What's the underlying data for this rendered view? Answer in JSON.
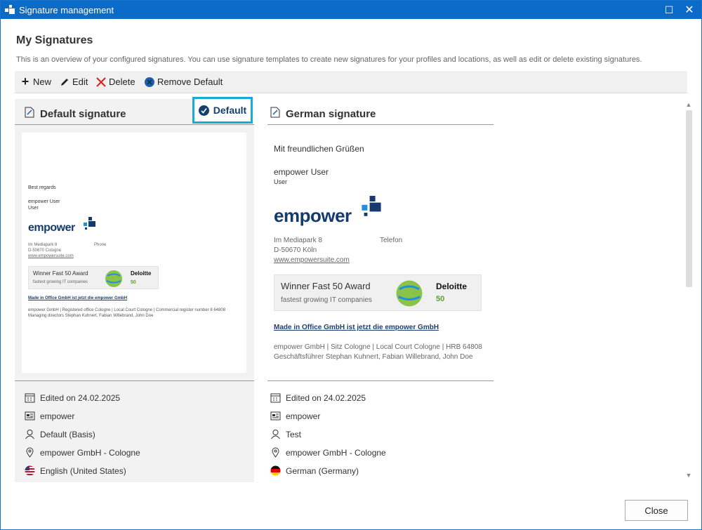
{
  "window": {
    "title": "Signature management"
  },
  "page": {
    "title": "My Signatures",
    "description": "This is an overview of your configured signatures. You can use signature templates to create new signatures for your profiles and locations, as well as edit or delete existing signatures."
  },
  "toolbar": {
    "new_label": "New",
    "edit_label": "Edit",
    "delete_label": "Delete",
    "remove_default_label": "Remove Default"
  },
  "cards": [
    {
      "title": "Default signature",
      "badge": "Default",
      "preview": {
        "greeting": "Best regards",
        "name": "empower User",
        "role": "User",
        "logo": "empower",
        "address1": "Im Mediapark 8",
        "address2": "D-50670 Cologne",
        "website": "www.empowersuite.com",
        "phone_label": "Phone",
        "award_title": "Winner Fast 50 Award",
        "award_sub": "fastest growing IT companies",
        "deloitte": "Deloitte",
        "fifty": "50",
        "made_in": "Made in Office GmbH ist jetzt die empower GmbH",
        "footer1": "empower GmbH | Registered office Cologne | Local Court Cologne | Commercial register number 8 64808",
        "footer2": "Managing directors Stephan Kuhnert, Fabian Willebrand, John Doe"
      },
      "meta": {
        "edited": "Edited on 24.02.2025",
        "company": "empower",
        "profile": "Default (Basis)",
        "location": "empower GmbH - Cologne",
        "language": "English (United States)"
      }
    },
    {
      "title": "German signature",
      "preview": {
        "greeting": "Mit freundlichen Grüßen",
        "name": "empower User",
        "role": "User",
        "logo": "empower",
        "address1": "Im Mediapark 8",
        "address2": "D-50670 Köln",
        "website": "www.empowersuite.com",
        "phone_label": "Telefon",
        "award_title": "Winner Fast 50 Award",
        "award_sub": "fastest growing IT companies",
        "deloitte": "Deloitte",
        "fifty": "50",
        "made_in": "Made in Office GmbH ist jetzt die empower GmbH",
        "footer1": "empower GmbH | Sitz Cologne | Local Court Cologne | HRB 64808",
        "footer2": "Geschäftsführer Stephan Kuhnert, Fabian Willebrand, John Doe"
      },
      "meta": {
        "edited": "Edited on 24.02.2025",
        "company": "empower",
        "profile": "Test",
        "location": "empower GmbH - Cologne",
        "language": "German (Germany)"
      }
    }
  ],
  "footer": {
    "close_label": "Close"
  },
  "colors": {
    "titlebar": "#0b6bc8",
    "highlight": "#1ba9d8",
    "brand": "#153a6e"
  },
  "icons": [
    "app-icon",
    "maximize-icon",
    "close-icon",
    "plus-icon",
    "pencil-icon",
    "delete-x-icon",
    "remove-default-icon",
    "document-icon",
    "check-circle-icon",
    "calendar-icon",
    "company-card-icon",
    "user-icon",
    "location-pin-icon",
    "us-flag-icon",
    "german-flag-icon"
  ]
}
